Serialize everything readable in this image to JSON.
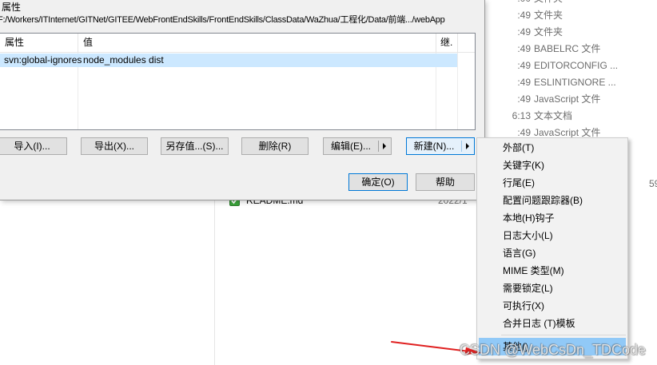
{
  "explorer": {
    "rows": [
      {
        "time": ":00",
        "type": "文件夹"
      },
      {
        "time": ":49",
        "type": "文件夹"
      },
      {
        "time": ":49",
        "type": "文件夹"
      },
      {
        "time": ":49",
        "type": "BABELRC 文件"
      },
      {
        "time": ":49",
        "type": "EDITORCONFIG ..."
      },
      {
        "time": ":49",
        "type": "ESLINTIGNORE ..."
      },
      {
        "time": ":49",
        "type": "JavaScript 文件"
      },
      {
        "time": "6:13",
        "type": "文本文档"
      },
      {
        "time": ":49",
        "type": "JavaScript 文件"
      }
    ],
    "readme": {
      "name": "README.md",
      "date": "2022/1",
      "status_icon": "svn-check-overlay-icon"
    },
    "size_fragment": "59"
  },
  "dialog": {
    "section_label": "属性",
    "path": "F:/Workers/ITInternet/GITNet/GITEE/WebFrontEndSkills/FrontEndSkills/ClassData/WaZhua/工程化/Data/前端.../webApp",
    "table": {
      "headers": {
        "property": "属性",
        "value": "值",
        "inherit": "继."
      },
      "rows": [
        {
          "property": "svn:global-ignores",
          "value": "node_modules dist"
        }
      ]
    },
    "buttons": {
      "import": "导入(I)...",
      "export": "导出(X)...",
      "save_value": "另存值...(S)...",
      "delete": "删除(R)",
      "edit": "编辑(E)...",
      "new": "新建(N)...",
      "ok": "确定(O)",
      "help": "帮助"
    },
    "split_arrow_icon": "triangle-right-icon"
  },
  "context_menu": {
    "items": [
      "外部(T)",
      "关键字(K)",
      "行尾(E)",
      "配置问题跟踪器(B)",
      "本地(H)钩子",
      "日志大小(L)",
      "语言(G)",
      "MIME 类型(M)",
      "需要锁定(L)",
      "可执行(X)",
      "合并日志 (T)模板"
    ],
    "highlighted_item": "其他()"
  },
  "annotation": {
    "icon": "red-arrow-icon"
  },
  "watermark": "CSDN @WebCsDn_TDCode",
  "colors": {
    "selection": "#cce8ff",
    "menu_highlight": "#91c9f7",
    "accent": "#0078d7",
    "annotation_arrow": "#e02020",
    "svn_ok": "#3ca53c"
  }
}
